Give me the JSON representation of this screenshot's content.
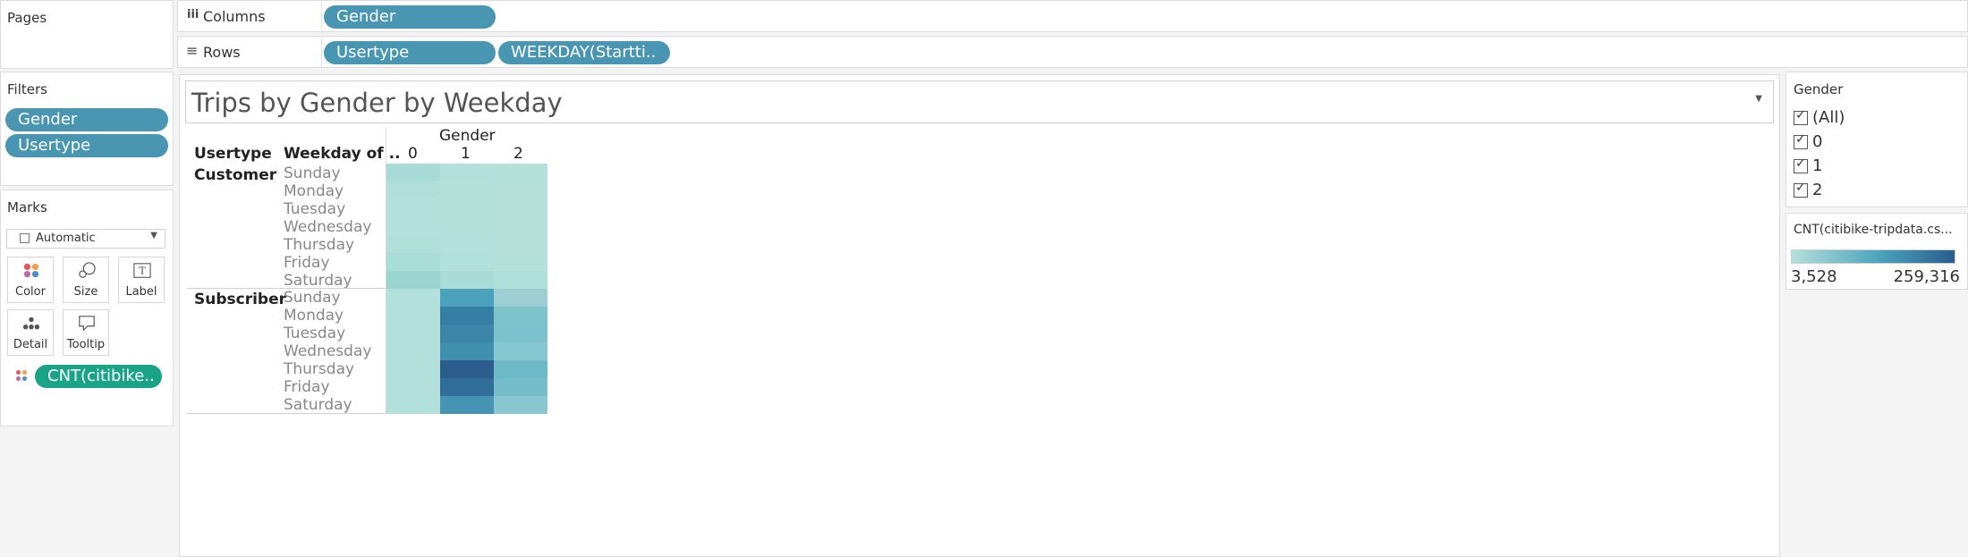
{
  "pages": {
    "title": "Pages"
  },
  "columns": {
    "label": "Columns",
    "pills": [
      "Gender"
    ]
  },
  "rows": {
    "label": "Rows",
    "pills": [
      "Usertype",
      "WEEKDAY(Startti.."
    ]
  },
  "filters": {
    "title": "Filters",
    "pills": [
      "Gender",
      "Usertype"
    ]
  },
  "marks": {
    "title": "Marks",
    "type": "Automatic",
    "buttons": [
      "Color",
      "Size",
      "Label",
      "Detail",
      "Tooltip"
    ],
    "color_pill": "CNT(citibike.."
  },
  "view": {
    "title": "Trips by Gender by Weekday",
    "column_group": "Gender",
    "column_header_usertype": "Usertype",
    "column_header_weekday": "Weekday of ..",
    "gender_values": [
      "0",
      "1",
      "2"
    ],
    "groups": [
      {
        "name": "Customer",
        "days": [
          "Sunday",
          "Monday",
          "Tuesday",
          "Wednesday",
          "Thursday",
          "Friday",
          "Saturday"
        ]
      },
      {
        "name": "Subscriber",
        "days": [
          "Sunday",
          "Monday",
          "Tuesday",
          "Wednesday",
          "Thursday",
          "Friday",
          "Saturday"
        ]
      }
    ]
  },
  "heatmap_colors": {
    "Customer": [
      [
        "#a6dbd6",
        "#b3e0da",
        "#b5e1db"
      ],
      [
        "#b0dfd9",
        "#b5e1db",
        "#b6e1db"
      ],
      [
        "#b2e0da",
        "#b5e1db",
        "#b6e1db"
      ],
      [
        "#b2e0da",
        "#b5e1db",
        "#b6e1db"
      ],
      [
        "#b0dfd9",
        "#b4e1db",
        "#b6e1db"
      ],
      [
        "#a8dcd7",
        "#b2e0da",
        "#b5e1db"
      ],
      [
        "#9bd5d1",
        "#a9dcd7",
        "#aedfd9"
      ]
    ],
    "Subscriber": [
      [
        "#b2e0da",
        "#4aa1bb",
        "#9bcfd3"
      ],
      [
        "#b3e0da",
        "#357fa4",
        "#7ec2cc"
      ],
      [
        "#b3e0da",
        "#3a85a8",
        "#7cc1cb"
      ],
      [
        "#b3e0da",
        "#3f8fae",
        "#86c6cf"
      ],
      [
        "#b3e0da",
        "#2b5d8d",
        "#6db9c6"
      ],
      [
        "#b3e0da",
        "#306d98",
        "#74bdc9"
      ],
      [
        "#b3e0da",
        "#4694b4",
        "#88c7cf"
      ]
    ]
  },
  "gender_filter": {
    "title": "Gender",
    "options": [
      "(All)",
      "0",
      "1",
      "2"
    ]
  },
  "legend": {
    "title": "CNT(citibike-tripdata.cs...",
    "min_label": "3,528",
    "max_label": "259,316",
    "color_low": "#b3e0da",
    "color_high": "#2b5d8d"
  }
}
